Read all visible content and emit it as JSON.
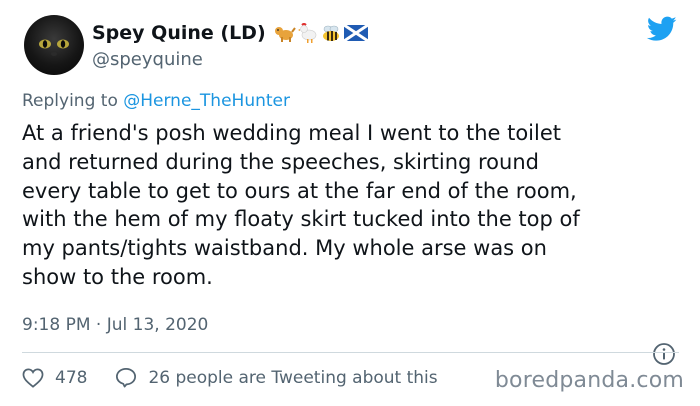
{
  "author": {
    "display_name": "Spey Quine (LD)",
    "handle": "@speyquine",
    "name_emoji": [
      "dog-emoji",
      "chicken-emoji",
      "bee-emoji",
      "scotland-flag-emoji"
    ]
  },
  "reply": {
    "prefix": "Replying to",
    "mention": "@Herne_TheHunter"
  },
  "tweet": {
    "text": "At a friend's posh wedding meal I went to the toilet\nand returned during the speeches, skirting round\nevery table to get to ours at the far end of the room,\nwith the hem of my floaty skirt tucked into the top of\nmy pants/tights waistband. My whole arse was on\nshow to the room.",
    "timestamp": "9:18 PM · Jul 13, 2020"
  },
  "actions": {
    "likes": "478",
    "conversation": "26 people are Tweeting about this"
  },
  "watermark": "boredpanda.com",
  "colors": {
    "twitter_blue": "#1da1f2",
    "mention": "#1b95e0",
    "secondary_text": "#536471"
  }
}
